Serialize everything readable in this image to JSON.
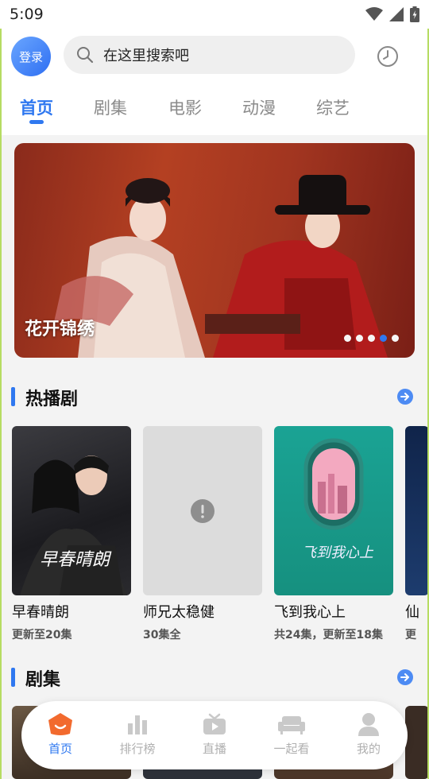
{
  "status_bar": {
    "time": "5:09"
  },
  "header": {
    "login_label": "登录",
    "search_placeholder": "在这里搜索吧"
  },
  "tabs": [
    {
      "label": "首页",
      "active": true
    },
    {
      "label": "剧集"
    },
    {
      "label": "电影"
    },
    {
      "label": "动漫"
    },
    {
      "label": "综艺"
    }
  ],
  "banner": {
    "caption": "花开锦绣",
    "dots_count": 5,
    "active_dot": 4
  },
  "hot_section": {
    "title": "热播剧",
    "items": [
      {
        "title": "早春晴朗",
        "sub": "更新至20集"
      },
      {
        "title": "师兄太稳健",
        "sub": "30集全"
      },
      {
        "title": "飞到我心上",
        "sub": "共24集，更新至18集"
      },
      {
        "title": "仙",
        "sub": "更"
      }
    ]
  },
  "series_section": {
    "title": "剧集"
  },
  "bottom_nav": [
    {
      "label": "首页",
      "icon": "home-icon",
      "active": true
    },
    {
      "label": "排行榜",
      "icon": "ranking-icon"
    },
    {
      "label": "直播",
      "icon": "live-tv-icon"
    },
    {
      "label": "一起看",
      "icon": "sofa-icon"
    },
    {
      "label": "我的",
      "icon": "profile-icon"
    }
  ],
  "colors": {
    "accent": "#2f78f0",
    "frame": "#b6dc62"
  }
}
